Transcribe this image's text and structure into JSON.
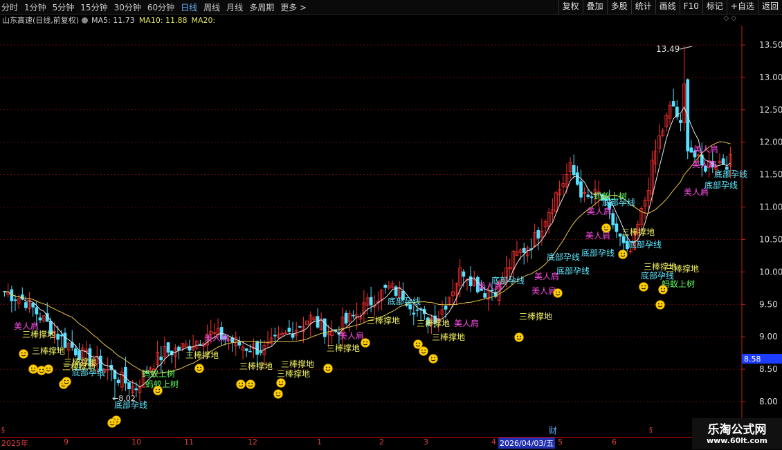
{
  "toolbar": {
    "periods": [
      "分时",
      "1分钟",
      "5分钟",
      "15分钟",
      "30分钟",
      "60分钟",
      "日线",
      "周线",
      "月线",
      "多周期",
      "更多 >"
    ],
    "active_period": "日线",
    "tools": [
      "复权",
      "叠加",
      "多股",
      "统计",
      "画线",
      "F10",
      "标记",
      "+自选",
      "返回"
    ]
  },
  "info": {
    "stock_name": "山东高速(日线,前复权)",
    "ma5": "MA5: 11.73",
    "ma10": "MA10: 11.88",
    "ma20": "MA20:",
    "icons": [
      "diamond-outline-icon",
      "diamond-outline-icon"
    ]
  },
  "chart_data": {
    "type": "candlestick",
    "y_ticks": [
      8.0,
      8.5,
      9.0,
      9.5,
      10.0,
      10.5,
      11.0,
      11.5,
      12.0,
      12.5,
      13.0,
      13.5
    ],
    "y_tick_labels": [
      "8.00",
      "8.50",
      "9.00",
      "9.50",
      "10.00",
      "10.50",
      "11.00",
      "11.50",
      "12.00",
      "12.50",
      "13.00",
      "13.50"
    ],
    "ylim": [
      7.7,
      13.8
    ],
    "current_price_label": "8.58",
    "max_label": "13.49",
    "min_label": "8.02",
    "x_labels": [
      "2025年",
      "9",
      "10",
      "11",
      "12",
      "1",
      "2",
      "3",
      "4",
      "2026/04/03/五",
      "5",
      "6"
    ],
    "fin_marker": "财",
    "ma_colors": {
      "ma5": "#e8e8e8",
      "ma20": "#e8c84a"
    },
    "colors": {
      "up": "#ff3030",
      "down": "#54e0ff"
    },
    "close_path": [
      [
        0,
        9.7
      ],
      [
        0.03,
        9.55
      ],
      [
        0.05,
        9.3
      ],
      [
        0.08,
        8.95
      ],
      [
        0.11,
        8.7
      ],
      [
        0.14,
        8.5
      ],
      [
        0.16,
        8.35
      ],
      [
        0.18,
        8.2
      ],
      [
        0.2,
        8.55
      ],
      [
        0.22,
        8.75
      ],
      [
        0.25,
        8.85
      ],
      [
        0.28,
        9.05
      ],
      [
        0.3,
        9.0
      ],
      [
        0.33,
        8.85
      ],
      [
        0.36,
        8.8
      ],
      [
        0.39,
        9.05
      ],
      [
        0.42,
        9.3
      ],
      [
        0.45,
        9.05
      ],
      [
        0.48,
        9.3
      ],
      [
        0.51,
        9.6
      ],
      [
        0.53,
        9.75
      ],
      [
        0.55,
        9.65
      ],
      [
        0.58,
        9.25
      ],
      [
        0.6,
        9.35
      ],
      [
        0.63,
        10.05
      ],
      [
        0.66,
        9.7
      ],
      [
        0.68,
        9.75
      ],
      [
        0.7,
        10.2
      ],
      [
        0.73,
        10.5
      ],
      [
        0.76,
        11.2
      ],
      [
        0.78,
        11.6
      ],
      [
        0.8,
        11.1
      ],
      [
        0.82,
        11.2
      ],
      [
        0.84,
        10.7
      ],
      [
        0.86,
        10.2
      ],
      [
        0.88,
        11.0
      ],
      [
        0.9,
        12.0
      ],
      [
        0.92,
        12.6
      ],
      [
        0.94,
        12.0
      ],
      [
        0.96,
        11.6
      ],
      [
        0.975,
        11.7
      ],
      [
        1.0,
        11.7
      ]
    ],
    "signals": [
      {
        "text": "美人肩",
        "color": "#ff4de8",
        "x": 20,
        "y": 476
      },
      {
        "text": "三棒撑地",
        "color": "#f0f060",
        "x": 32,
        "y": 488
      },
      {
        "text": "三棒撑地",
        "color": "#f0f060",
        "x": 46,
        "y": 512
      },
      {
        "text": "三棒撑地",
        "color": "#f0f060",
        "x": 92,
        "y": 528
      },
      {
        "text": "底部孕线",
        "color": "#60e8ff",
        "x": 104,
        "y": 543
      },
      {
        "text": "三棒撑地",
        "color": "#f0f060",
        "x": 90,
        "y": 535
      },
      {
        "text": "底部孕线",
        "color": "#60e8ff",
        "x": 165,
        "y": 590
      },
      {
        "text": "蚂蚁上树",
        "color": "#60ff60",
        "x": 205,
        "y": 545
      },
      {
        "text": "蚂蚁上树",
        "color": "#60ff60",
        "x": 210,
        "y": 560
      },
      {
        "text": "三棒撑地",
        "color": "#f0f060",
        "x": 268,
        "y": 518
      },
      {
        "text": "美人肩",
        "color": "#ff4de8",
        "x": 295,
        "y": 493
      },
      {
        "text": "三棒撑地",
        "color": "#f0f060",
        "x": 346,
        "y": 534
      },
      {
        "text": "三棒撑地",
        "color": "#f0f060",
        "x": 400,
        "y": 545
      },
      {
        "text": "三棒撑地",
        "color": "#f0f060",
        "x": 406,
        "y": 531
      },
      {
        "text": "三棒撑地",
        "color": "#f0f060",
        "x": 472,
        "y": 508
      },
      {
        "text": "美人肩",
        "color": "#ff4de8",
        "x": 490,
        "y": 490
      },
      {
        "text": "三棒撑地",
        "color": "#f0f060",
        "x": 530,
        "y": 468
      },
      {
        "text": "底部孕线",
        "color": "#60e8ff",
        "x": 560,
        "y": 440
      },
      {
        "text": "三棒撑地",
        "color": "#f0f060",
        "x": 602,
        "y": 472
      },
      {
        "text": "三棒撑地",
        "color": "#f0f060",
        "x": 624,
        "y": 492
      },
      {
        "text": "美人肩",
        "color": "#ff4de8",
        "x": 656,
        "y": 472
      },
      {
        "text": "美人肩",
        "color": "#ff4de8",
        "x": 690,
        "y": 418
      },
      {
        "text": "底部孕线",
        "color": "#60e8ff",
        "x": 710,
        "y": 410
      },
      {
        "text": "美人肩",
        "color": "#ff4de8",
        "x": 768,
        "y": 425
      },
      {
        "text": "三棒撑地",
        "color": "#f0f060",
        "x": 750,
        "y": 462
      },
      {
        "text": "美人肩",
        "color": "#ff4de8",
        "x": 772,
        "y": 404
      },
      {
        "text": "底部孕线",
        "color": "#60e8ff",
        "x": 804,
        "y": 396
      },
      {
        "text": "底部孕线",
        "color": "#60e8ff",
        "x": 790,
        "y": 376
      },
      {
        "text": "底部孕线",
        "color": "#60e8ff",
        "x": 840,
        "y": 370
      },
      {
        "text": "美人肩",
        "color": "#ff4de8",
        "x": 846,
        "y": 345
      },
      {
        "text": "美人肩",
        "color": "#ff4de8",
        "x": 848,
        "y": 310
      },
      {
        "text": "蚂蚁上树",
        "color": "#60ff60",
        "x": 858,
        "y": 288
      },
      {
        "text": "底部孕线",
        "color": "#60e8ff",
        "x": 870,
        "y": 297
      },
      {
        "text": "三棒撑地",
        "color": "#f0f060",
        "x": 898,
        "y": 340
      },
      {
        "text": "底部孕线",
        "color": "#60e8ff",
        "x": 908,
        "y": 358
      },
      {
        "text": "三棒撑地",
        "color": "#f0f060",
        "x": 930,
        "y": 390
      },
      {
        "text": "底部孕线",
        "color": "#60e8ff",
        "x": 926,
        "y": 403
      },
      {
        "text": "三棒撑地",
        "color": "#f0f060",
        "x": 962,
        "y": 393
      },
      {
        "text": "蚂蚁上树",
        "color": "#60ff60",
        "x": 956,
        "y": 415
      },
      {
        "text": "美人肩",
        "color": "#ff4de8",
        "x": 988,
        "y": 282
      },
      {
        "text": "美人肩",
        "color": "#ff4de8",
        "x": 1000,
        "y": 242
      },
      {
        "text": "美人肩",
        "color": "#ff4de8",
        "x": 1002,
        "y": 220
      },
      {
        "text": "底部孕线",
        "color": "#60e8ff",
        "x": 1018,
        "y": 272
      },
      {
        "text": "底部孕线",
        "color": "#60e8ff",
        "x": 1032,
        "y": 256
      }
    ],
    "smileys": [
      [
        34,
        512
      ],
      [
        48,
        534
      ],
      [
        60,
        536
      ],
      [
        70,
        534
      ],
      [
        92,
        556
      ],
      [
        96,
        552
      ],
      [
        168,
        608
      ],
      [
        162,
        612
      ],
      [
        228,
        565
      ],
      [
        288,
        533
      ],
      [
        348,
        556
      ],
      [
        362,
        556
      ],
      [
        402,
        570
      ],
      [
        406,
        554
      ],
      [
        474,
        533
      ],
      [
        528,
        496
      ],
      [
        604,
        498
      ],
      [
        612,
        508
      ],
      [
        626,
        519
      ],
      [
        750,
        488
      ],
      [
        806,
        424
      ],
      [
        876,
        330
      ],
      [
        900,
        368
      ],
      [
        930,
        415
      ],
      [
        958,
        419
      ],
      [
        954,
        441
      ]
    ]
  },
  "watermark": {
    "line1": "乐淘公式网",
    "line2": "www.60lt.com"
  }
}
